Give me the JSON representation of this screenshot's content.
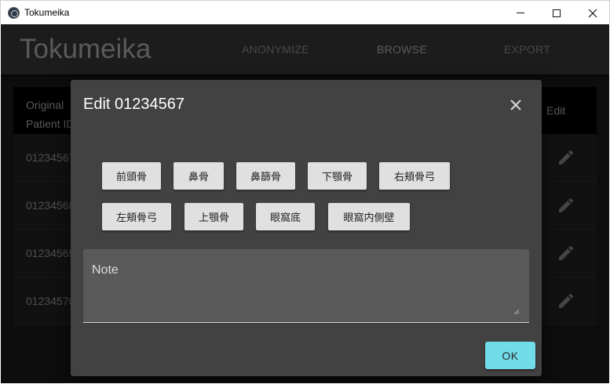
{
  "window": {
    "title": "Tokumeika",
    "icon": "app-logo-icon",
    "controls": [
      "minimize-icon",
      "maximize-icon",
      "close-icon"
    ]
  },
  "appbar": {
    "brand": "Tokumeika",
    "nav": {
      "anonymize": "ANONYMIZE",
      "browse": "BROWSE",
      "export": "EXPORT"
    }
  },
  "table": {
    "headers": {
      "original_line1": "Original",
      "original_line2": "Patient ID",
      "edit": "Edit"
    },
    "rows": [
      {
        "patient_id": "01234567"
      },
      {
        "patient_id": "01234568"
      },
      {
        "patient_id": "01234569"
      },
      {
        "patient_id": "01234570"
      }
    ]
  },
  "dialog": {
    "title": "Edit 01234567",
    "tags": [
      "前頭骨",
      "鼻骨",
      "鼻篩骨",
      "下顎骨",
      "右頬骨弓",
      "左頬骨弓",
      "上顎骨",
      "眼窩底",
      "眼窩内側壁"
    ],
    "note_label": "Note",
    "note_value": "",
    "ok_label": "OK"
  },
  "colors": {
    "accent": "#70dde8",
    "dialog_bg": "#424242",
    "chip_bg": "#e0e0e0"
  }
}
